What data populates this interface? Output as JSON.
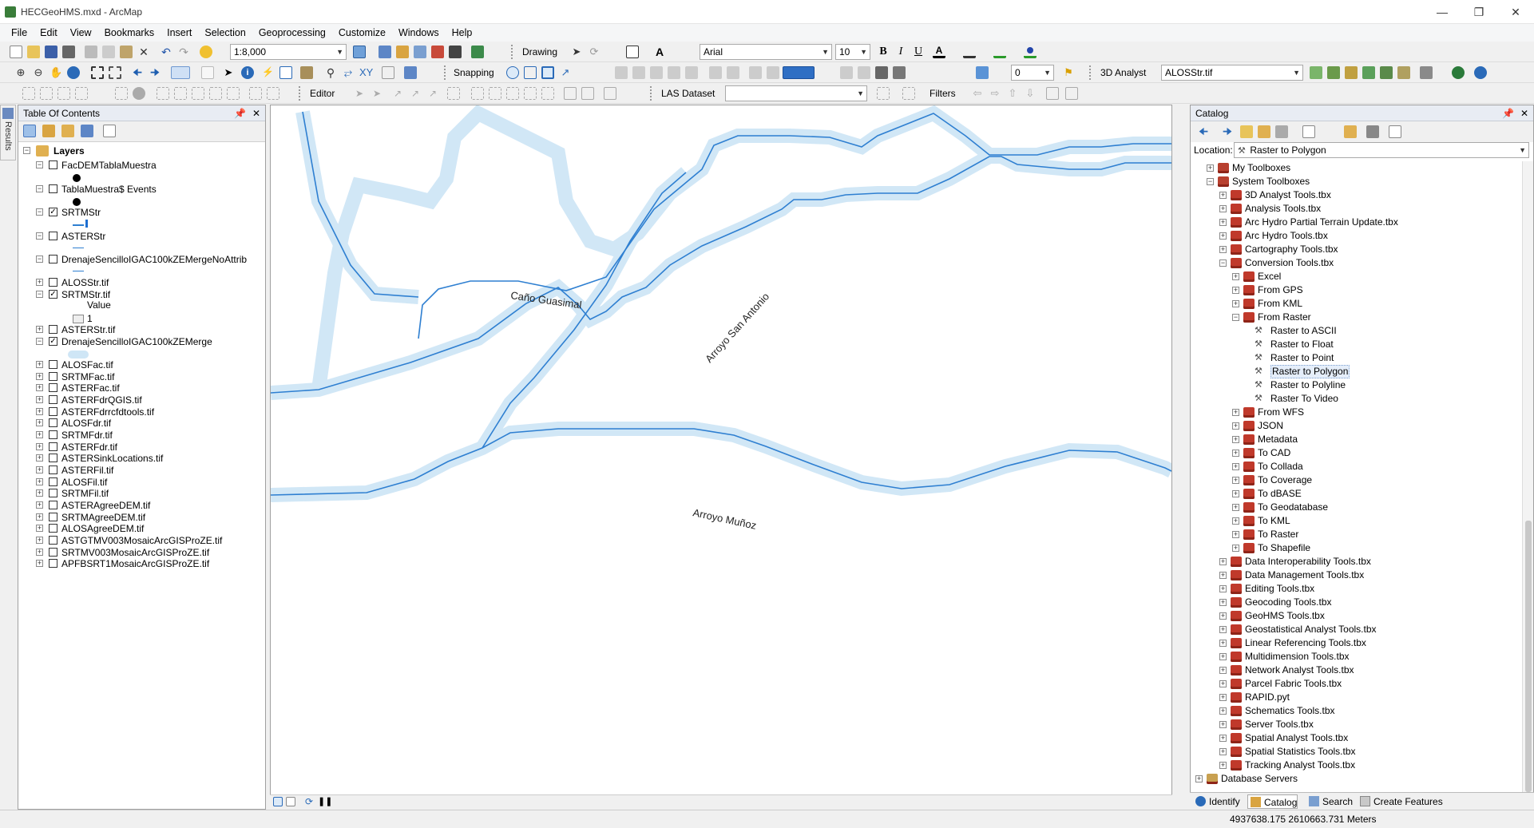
{
  "window": {
    "title": "HECGeoHMS.mxd - ArcMap"
  },
  "menu": [
    "File",
    "Edit",
    "View",
    "Bookmarks",
    "Insert",
    "Selection",
    "Geoprocessing",
    "Customize",
    "Windows",
    "Help"
  ],
  "toolbar": {
    "scale": "1:8,000",
    "drawing_label": "Drawing",
    "font_name": "Arial",
    "font_size": "10",
    "snapping_label": "Snapping",
    "layer_combo": "0",
    "analyst3d_label": "3D Analyst",
    "analyst3d_layer": "ALOSStr.tif",
    "editor_label": "Editor",
    "las_label": "LAS Dataset",
    "filters_label": "Filters"
  },
  "colors": {
    "accent": "#1e7ed4",
    "river_buffer": "#cfe6f6",
    "toolbox_red": "#c0392b"
  },
  "toc": {
    "title": "Table Of Contents",
    "root": "Layers",
    "layers": [
      {
        "label": "FacDEMTablaMuestra",
        "checked": false
      },
      {
        "label": "TablaMuestra$ Events",
        "checked": false
      },
      {
        "label": "SRTMStr",
        "checked": true
      },
      {
        "label": "ASTERStr",
        "checked": false
      },
      {
        "label": "DrenajeSencilloIGAC100kZEMergeNoAttrib",
        "checked": false
      },
      {
        "label": "ALOSStr.tif",
        "checked": false
      },
      {
        "label": "SRTMStr.tif",
        "checked": true
      },
      {
        "label": "ASTERStr.tif",
        "checked": false
      },
      {
        "label": "DrenajeSencilloIGAC100kZEMerge",
        "checked": true
      },
      {
        "label": "ALOSFac.tif",
        "checked": false
      },
      {
        "label": "SRTMFac.tif",
        "checked": false
      },
      {
        "label": "ASTERFac.tif",
        "checked": false
      },
      {
        "label": "ASTERFdrQGIS.tif",
        "checked": false
      },
      {
        "label": "ASTERFdrrcfdtools.tif",
        "checked": false
      },
      {
        "label": "ALOSFdr.tif",
        "checked": false
      },
      {
        "label": "SRTMFdr.tif",
        "checked": false
      },
      {
        "label": "ASTERFdr.tif",
        "checked": false
      },
      {
        "label": "ASTERSinkLocations.tif",
        "checked": false
      },
      {
        "label": "ASTERFil.tif",
        "checked": false
      },
      {
        "label": "ALOSFil.tif",
        "checked": false
      },
      {
        "label": "SRTMFil.tif",
        "checked": false
      },
      {
        "label": "ASTERAgreeDEM.tif",
        "checked": false
      },
      {
        "label": "SRTMAgreeDEM.tif",
        "checked": false
      },
      {
        "label": "ALOSAgreeDEM.tif",
        "checked": false
      },
      {
        "label": "ASTGTMV003MosaicArcGISProZE.tif",
        "checked": false
      },
      {
        "label": "SRTMV003MosaicArcGISProZE.tif",
        "checked": false
      },
      {
        "label": "APFBSRT1MosaicArcGISProZE.tif",
        "checked": false
      }
    ],
    "legend_value_label": "Value",
    "legend_value": "1"
  },
  "map": {
    "labels": [
      "Caño Guasimal",
      "Arroyo San Antonio",
      "Arroyo Muñoz"
    ]
  },
  "catalog": {
    "title": "Catalog",
    "location_label": "Location:",
    "location_value": "Raster to Polygon",
    "items": [
      {
        "label": "My Toolboxes",
        "level": 1,
        "icon": "folder",
        "exp": "+"
      },
      {
        "label": "System Toolboxes",
        "level": 1,
        "icon": "folder",
        "exp": "-"
      },
      {
        "label": "3D Analyst Tools.tbx",
        "level": 2,
        "icon": "tbx",
        "exp": "+"
      },
      {
        "label": "Analysis Tools.tbx",
        "level": 2,
        "icon": "tbx",
        "exp": "+"
      },
      {
        "label": "Arc Hydro Partial Terrain Update.tbx",
        "level": 2,
        "icon": "tbx",
        "exp": "+"
      },
      {
        "label": "Arc Hydro Tools.tbx",
        "level": 2,
        "icon": "tbx",
        "exp": "+"
      },
      {
        "label": "Cartography Tools.tbx",
        "level": 2,
        "icon": "tbx",
        "exp": "+"
      },
      {
        "label": "Conversion Tools.tbx",
        "level": 2,
        "icon": "tbx",
        "exp": "-"
      },
      {
        "label": "Excel",
        "level": 3,
        "icon": "tbx",
        "exp": "+"
      },
      {
        "label": "From GPS",
        "level": 3,
        "icon": "tbx",
        "exp": "+"
      },
      {
        "label": "From KML",
        "level": 3,
        "icon": "tbx",
        "exp": "+"
      },
      {
        "label": "From Raster",
        "level": 3,
        "icon": "tbx",
        "exp": "-"
      },
      {
        "label": "Raster to ASCII",
        "level": 4,
        "icon": "tool",
        "exp": ""
      },
      {
        "label": "Raster to Float",
        "level": 4,
        "icon": "tool",
        "exp": ""
      },
      {
        "label": "Raster to Point",
        "level": 4,
        "icon": "tool",
        "exp": ""
      },
      {
        "label": "Raster to Polygon",
        "level": 4,
        "icon": "tool",
        "exp": ""
      },
      {
        "label": "Raster to Polyline",
        "level": 4,
        "icon": "tool",
        "exp": ""
      },
      {
        "label": "Raster To Video",
        "level": 4,
        "icon": "tool",
        "exp": ""
      },
      {
        "label": "From WFS",
        "level": 3,
        "icon": "tbx",
        "exp": "+"
      },
      {
        "label": "JSON",
        "level": 3,
        "icon": "tbx",
        "exp": "+"
      },
      {
        "label": "Metadata",
        "level": 3,
        "icon": "tbx",
        "exp": "+"
      },
      {
        "label": "To CAD",
        "level": 3,
        "icon": "tbx",
        "exp": "+"
      },
      {
        "label": "To Collada",
        "level": 3,
        "icon": "tbx",
        "exp": "+"
      },
      {
        "label": "To Coverage",
        "level": 3,
        "icon": "tbx",
        "exp": "+"
      },
      {
        "label": "To dBASE",
        "level": 3,
        "icon": "tbx",
        "exp": "+"
      },
      {
        "label": "To Geodatabase",
        "level": 3,
        "icon": "tbx",
        "exp": "+"
      },
      {
        "label": "To KML",
        "level": 3,
        "icon": "tbx",
        "exp": "+"
      },
      {
        "label": "To Raster",
        "level": 3,
        "icon": "tbx",
        "exp": "+"
      },
      {
        "label": "To Shapefile",
        "level": 3,
        "icon": "tbx",
        "exp": "+"
      },
      {
        "label": "Data Interoperability Tools.tbx",
        "level": 2,
        "icon": "tbx",
        "exp": "+"
      },
      {
        "label": "Data Management Tools.tbx",
        "level": 2,
        "icon": "tbx",
        "exp": "+"
      },
      {
        "label": "Editing Tools.tbx",
        "level": 2,
        "icon": "tbx",
        "exp": "+"
      },
      {
        "label": "Geocoding Tools.tbx",
        "level": 2,
        "icon": "tbx",
        "exp": "+"
      },
      {
        "label": "GeoHMS Tools.tbx",
        "level": 2,
        "icon": "tbx",
        "exp": "+"
      },
      {
        "label": "Geostatistical Analyst Tools.tbx",
        "level": 2,
        "icon": "tbx",
        "exp": "+"
      },
      {
        "label": "Linear Referencing Tools.tbx",
        "level": 2,
        "icon": "tbx",
        "exp": "+"
      },
      {
        "label": "Multidimension Tools.tbx",
        "level": 2,
        "icon": "tbx",
        "exp": "+"
      },
      {
        "label": "Network Analyst Tools.tbx",
        "level": 2,
        "icon": "tbx",
        "exp": "+"
      },
      {
        "label": "Parcel Fabric Tools.tbx",
        "level": 2,
        "icon": "tbx",
        "exp": "+"
      },
      {
        "label": "RAPID.pyt",
        "level": 2,
        "icon": "tbx",
        "exp": "+"
      },
      {
        "label": "Schematics Tools.tbx",
        "level": 2,
        "icon": "tbx",
        "exp": "+"
      },
      {
        "label": "Server Tools.tbx",
        "level": 2,
        "icon": "tbx",
        "exp": "+"
      },
      {
        "label": "Spatial Analyst Tools.tbx",
        "level": 2,
        "icon": "tbx",
        "exp": "+"
      },
      {
        "label": "Spatial Statistics Tools.tbx",
        "level": 2,
        "icon": "tbx",
        "exp": "+"
      },
      {
        "label": "Tracking Analyst Tools.tbx",
        "level": 2,
        "icon": "tbx",
        "exp": "+"
      },
      {
        "label": "Database Servers",
        "level": 0,
        "icon": "folder",
        "exp": "+"
      }
    ]
  },
  "bottom_tabs": [
    "Identify",
    "Catalog",
    "Search",
    "Create Features"
  ],
  "side_tab": "Results",
  "status": {
    "coords": "4937638.175  2610663.731 Meters"
  }
}
